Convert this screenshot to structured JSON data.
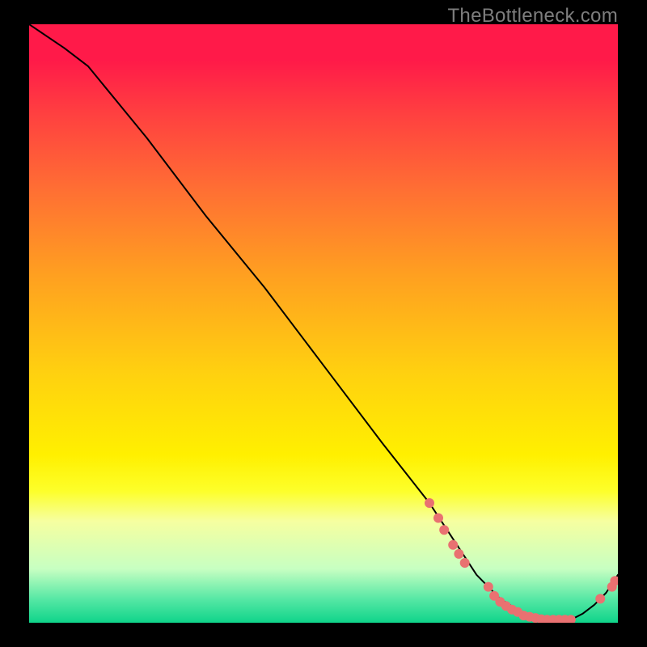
{
  "attribution": "TheBottleneck.com",
  "chart_data": {
    "type": "line",
    "title": "",
    "xlabel": "",
    "ylabel": "",
    "xlim": [
      0,
      100
    ],
    "ylim": [
      0,
      100
    ],
    "grid": false,
    "legend": false,
    "series": [
      {
        "name": "bottleneck-curve",
        "x": [
          0,
          6,
          10,
          20,
          30,
          40,
          50,
          60,
          68,
          72,
          76,
          80,
          84,
          88,
          92,
          94,
          96,
          98,
          100
        ],
        "y": [
          100,
          96,
          93,
          81,
          68,
          56,
          43,
          30,
          20,
          14,
          8,
          4,
          1.5,
          0.5,
          0.5,
          1.5,
          3,
          5,
          8
        ],
        "color": "#000000"
      }
    ],
    "points": [
      {
        "x": 68,
        "y": 20
      },
      {
        "x": 69.5,
        "y": 17.5
      },
      {
        "x": 70.5,
        "y": 15.5
      },
      {
        "x": 72,
        "y": 13
      },
      {
        "x": 73,
        "y": 11.5
      },
      {
        "x": 74,
        "y": 10
      },
      {
        "x": 78,
        "y": 6
      },
      {
        "x": 79,
        "y": 4.5
      },
      {
        "x": 80,
        "y": 3.5
      },
      {
        "x": 81,
        "y": 2.8
      },
      {
        "x": 82,
        "y": 2.2
      },
      {
        "x": 83,
        "y": 1.8
      },
      {
        "x": 84,
        "y": 1.2
      },
      {
        "x": 85,
        "y": 1.0
      },
      {
        "x": 86,
        "y": 0.8
      },
      {
        "x": 87,
        "y": 0.6
      },
      {
        "x": 88,
        "y": 0.5
      },
      {
        "x": 89,
        "y": 0.5
      },
      {
        "x": 90,
        "y": 0.5
      },
      {
        "x": 91,
        "y": 0.5
      },
      {
        "x": 92,
        "y": 0.5
      },
      {
        "x": 97,
        "y": 4
      },
      {
        "x": 99,
        "y": 6
      },
      {
        "x": 99.5,
        "y": 7
      }
    ],
    "background_gradient": {
      "top": "#ff1a49",
      "mid": "#fff000",
      "bottom": "#0fd48a"
    }
  }
}
